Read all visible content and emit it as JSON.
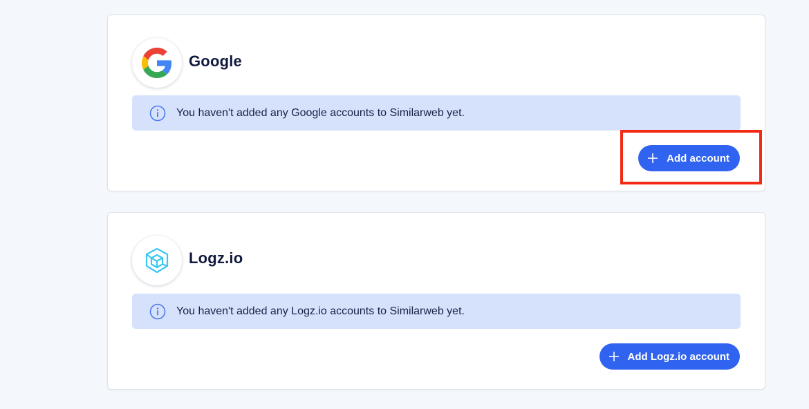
{
  "providers": [
    {
      "name": "Google",
      "logo_icon": "google-g-icon",
      "notice": "You haven't added any Google accounts to Similarweb yet.",
      "button_label": "Add account"
    },
    {
      "name": "Logz.io",
      "logo_icon": "logzio-cube-icon",
      "notice": "You haven't added any Logz.io accounts to Similarweb yet.",
      "button_label": "Add Logz.io account"
    }
  ],
  "colors": {
    "background": "#f4f7fb",
    "notice_bg": "#d6e2fb",
    "button": "#2f63f0",
    "highlight": "#f22a15",
    "logz_icon": "#3ac7f0"
  },
  "icons": {
    "info": "info-circle-icon",
    "plus": "plus-icon"
  }
}
